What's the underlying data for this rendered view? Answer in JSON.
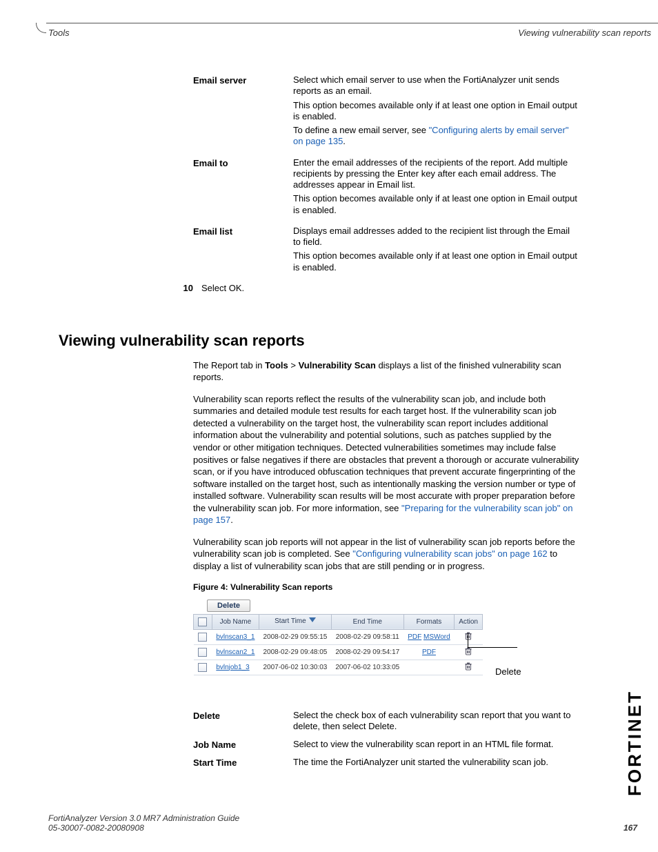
{
  "header": {
    "left": "Tools",
    "right": "Viewing vulnerability scan reports"
  },
  "definitions1": [
    {
      "term": "Email server",
      "paras": [
        "Select which email server to use when the FortiAnalyzer unit sends reports as an email.",
        "This option becomes available only if at least one option in Email output is enabled.",
        "To define a new email server, see "
      ],
      "link_text": "\"Configuring alerts by email server\" on page 135",
      "link_after": "."
    },
    {
      "term": "Email to",
      "paras": [
        "Enter the email addresses of the recipients of the report. Add multiple recipients by pressing the Enter key after each email address. The addresses appear in Email list.",
        "This option becomes available only if at least one option in Email output is enabled."
      ]
    },
    {
      "term": "Email list",
      "paras": [
        "Displays email addresses added to the recipient list through the Email to field.",
        "This option becomes available only if at least one option in Email output is enabled."
      ]
    }
  ],
  "step": {
    "num": "10",
    "text": "Select OK."
  },
  "heading": "Viewing vulnerability scan reports",
  "body": {
    "p1_a": "The Report tab in ",
    "p1_b1": "Tools",
    "p1_sep": " > ",
    "p1_b2": "Vulnerability Scan",
    "p1_c": " displays a list of the finished vulnerability scan reports.",
    "p2_a": "Vulnerability scan reports reflect the results of the vulnerability scan job, and include both summaries and detailed module test results for each target host. If the vulnerability scan job detected a vulnerability on the target host, the vulnerability scan report includes additional information about the vulnerability and potential solutions, such as patches supplied by the vendor or other mitigation techniques. Detected vulnerabilities sometimes may include false positives or false negatives if there are obstacles that prevent a thorough or accurate vulnerability scan, or if you have introduced obfuscation techniques that prevent accurate fingerprinting of the software installed on the target host, such as intentionally masking the version number or type of installed software. Vulnerability scan results will be most accurate with proper preparation before the vulnerability scan job. For more information, see ",
    "p2_link": "\"Preparing for the vulnerability scan job\" on page 157",
    "p2_b": ".",
    "p3_a": "Vulnerability scan job reports will not appear in the list of vulnerability scan job reports before the vulnerability scan job is completed. See ",
    "p3_link": "\"Configuring vulnerability scan jobs\" on page 162",
    "p3_b": " to display a list of vulnerability scan jobs that are still pending or in progress."
  },
  "figure": {
    "caption": "Figure 4:   Vulnerability Scan reports",
    "delete_btn": "Delete",
    "headers": [
      "",
      "Job Name",
      "Start Time",
      "End Time",
      "Formats",
      "Action"
    ],
    "rows": [
      {
        "job": "bvlnscan3_1",
        "start": "2008-02-29 09:55:15",
        "end": "2008-02-29 09:58:11",
        "formats": [
          "PDF",
          "MSWord"
        ]
      },
      {
        "job": "bvlnscan2_1",
        "start": "2008-02-29 09:48:05",
        "end": "2008-02-29 09:54:17",
        "formats": [
          "PDF"
        ]
      },
      {
        "job": "bvlnjob1_3",
        "start": "2007-06-02 10:30:03",
        "end": "2007-06-02 10:33:05",
        "formats": []
      }
    ],
    "callout": "Delete"
  },
  "definitions2": [
    {
      "term": "Delete",
      "desc": "Select the check box of each vulnerability scan report that you want to delete, then select Delete."
    },
    {
      "term": "Job Name",
      "desc": "Select to view the vulnerability scan report in an HTML file format."
    },
    {
      "term": "Start Time",
      "desc": "The time the FortiAnalyzer unit started the vulnerability scan job."
    }
  ],
  "footer": {
    "line1": "FortiAnalyzer Version 3.0 MR7 Administration Guide",
    "line2": "05-30007-0082-20080908",
    "page": "167"
  },
  "logo": "FORTINET"
}
